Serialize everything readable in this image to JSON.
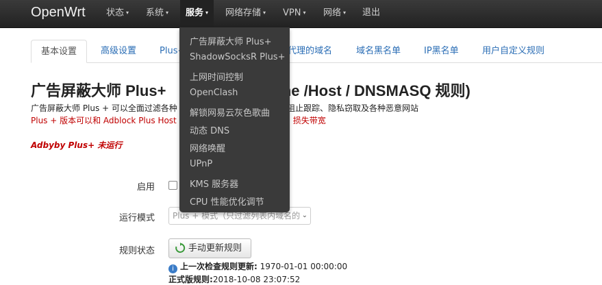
{
  "navbar": {
    "brand": "OpenWrt",
    "items": [
      {
        "label": "状态",
        "caret": "▾"
      },
      {
        "label": "系统",
        "caret": "▾"
      },
      {
        "label": "服务",
        "caret": "▾"
      },
      {
        "label": "网络存储",
        "caret": "▾"
      },
      {
        "label": "VPN",
        "caret": "▾"
      },
      {
        "label": "网络",
        "caret": "▾"
      },
      {
        "label": "退出"
      }
    ]
  },
  "tabs": [
    {
      "label": "基本设置"
    },
    {
      "label": "高级设置"
    },
    {
      "label": "Plus+"
    },
    {
      "label": "代理的域名"
    },
    {
      "label": "域名黑名单"
    },
    {
      "label": "IP黑名单"
    },
    {
      "label": "用户自定义规则"
    }
  ],
  "page": {
    "title": "广告屏蔽大师 Plus+",
    "title_tail": "rdHome /Host / DNSMASQ 规则)",
    "desc1_a": "广告屏蔽大师 Plus + 可以全面过滤各种",
    "desc1_b": "同时阻止跟踪、隐私窃取及各种恶意网站",
    "desc2_a": "Plus + 版本可以和 Adblock Plus Host",
    "desc2_b": "损失带宽",
    "status": "Adbyby Plus+ 未运行"
  },
  "form": {
    "enable_label": "启用",
    "mode_label": "运行模式",
    "mode_value": "Plus + 模式（只过滤列表内域名的",
    "rules_label": "规则状态",
    "update_button": "手动更新规则",
    "last_check_label": "上一次检查规则更新:",
    "last_check_value": "1970-01-01 00:00:00",
    "official_label": "正式版规则:",
    "official_value": "2018-10-08 23:07:52"
  },
  "dropdown": {
    "items": [
      "广告屏蔽大师 Plus+",
      "ShadowSocksR Plus+",
      "上网时间控制",
      "OpenClash",
      "解锁网易云灰色歌曲",
      "动态 DNS",
      "网络唤醒",
      "UPnP",
      "KMS 服务器",
      "CPU 性能优化调节"
    ]
  }
}
